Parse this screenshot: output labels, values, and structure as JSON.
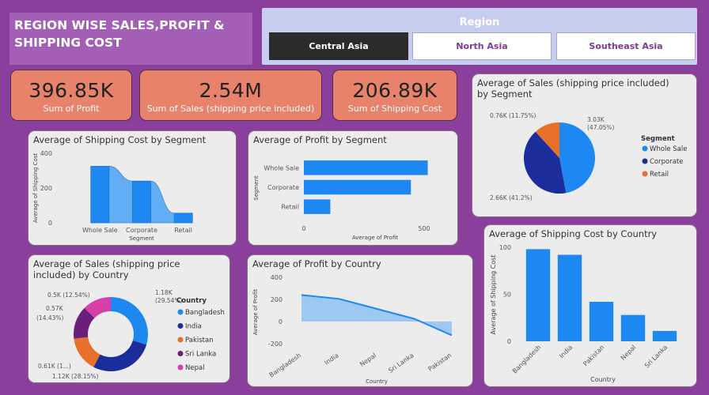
{
  "header": {
    "title": "REGION WISE SALES,PROFIT & SHIPPING COST"
  },
  "slicer": {
    "title": "Region",
    "options": [
      "Central Asia",
      "North Asia",
      "Southeast Asia"
    ],
    "selected": "Central Asia"
  },
  "kpis": [
    {
      "value": "396.85K",
      "label": "Sum of Profit"
    },
    {
      "value": "2.54M",
      "label": "Sum of Sales (shipping price included)"
    },
    {
      "value": "206.89K",
      "label": "Sum of Shipping Cost"
    }
  ],
  "colors": {
    "blue": "#1e88f2",
    "navy": "#1a2d9a",
    "orange": "#e8702a",
    "purple": "#6a1f7a",
    "pink": "#d63fa8",
    "background": "#8a3f9c",
    "kpi": "#e8826a"
  },
  "chart_data": [
    {
      "id": "ship_by_segment",
      "type": "bar",
      "title": "Average of Shipping Cost by Segment",
      "xlabel": "Segment",
      "ylabel": "Average of Shipping Cost",
      "categories": [
        "Whole Sale",
        "Corporate",
        "Retail"
      ],
      "values": [
        325,
        240,
        55
      ],
      "yticks": [
        "400",
        "200",
        "0"
      ],
      "ylim": [
        0,
        400
      ]
    },
    {
      "id": "profit_by_segment",
      "type": "bar",
      "orientation": "horizontal",
      "title": "Average of Profit by Segment",
      "xlabel": "Average of Profit",
      "ylabel": "Segment",
      "categories": [
        "Whole Sale",
        "Corporate",
        "Retail"
      ],
      "values": [
        515,
        445,
        110
      ],
      "xticks": [
        "0",
        "500"
      ],
      "xlim": [
        0,
        500
      ]
    },
    {
      "id": "sales_by_segment",
      "type": "pie",
      "title": "Average of Sales (shipping price included) by Segment",
      "legend_title": "Segment",
      "legend_position": "right",
      "slices": [
        {
          "name": "Whole Sale",
          "value": 47.05,
          "label": "3.03K\n(47.05%)",
          "color": "#1e88f2"
        },
        {
          "name": "Corporate",
          "value": 41.2,
          "label": "2.66K (41.2%)",
          "color": "#1a2d9a"
        },
        {
          "name": "Retail",
          "value": 11.75,
          "label": "0.76K (11.75%)",
          "color": "#e8702a"
        }
      ]
    },
    {
      "id": "sales_by_country",
      "type": "pie",
      "donut": true,
      "title": "Average of Sales (shipping price included) by Country",
      "legend_title": "Country",
      "legend_position": "right",
      "slices": [
        {
          "name": "Bangladesh",
          "value": 29.54,
          "label": "1.18K (29.54%)",
          "color": "#1e88f2"
        },
        {
          "name": "India",
          "value": 28.15,
          "label": "1.12K (28.15%)",
          "color": "#1a2d9a"
        },
        {
          "name": "Pakistan",
          "value": 15.34,
          "label": "0.61K (1...)",
          "color": "#e8702a"
        },
        {
          "name": "Sri Lanka",
          "value": 14.43,
          "label": "0.57K (14.43%)",
          "color": "#6a1f7a"
        },
        {
          "name": "Nepal",
          "value": 12.54,
          "label": "0.5K (12.54%)",
          "color": "#d63fa8"
        }
      ]
    },
    {
      "id": "profit_by_country",
      "type": "area",
      "title": "Average of Profit by Country",
      "xlabel": "Country",
      "ylabel": "Average of Profit",
      "categories": [
        "Bangladesh",
        "India",
        "Nepal",
        "Sri Lanka",
        "Pakistan"
      ],
      "values": [
        240,
        205,
        115,
        25,
        -125
      ],
      "yticks": [
        "400",
        "200",
        "0",
        "-200"
      ],
      "ylim": [
        -200,
        400
      ]
    },
    {
      "id": "ship_by_country",
      "type": "bar",
      "title": "Average of Shipping Cost by Country",
      "xlabel": "Country",
      "ylabel": "Average of Shipping Cost",
      "categories": [
        "Bangladesh",
        "India",
        "Pakistan",
        "Nepal",
        "Sri Lanka"
      ],
      "values": [
        98,
        92,
        42,
        28,
        11
      ],
      "yticks": [
        "100",
        "50",
        "0"
      ],
      "ylim": [
        0,
        100
      ]
    }
  ]
}
